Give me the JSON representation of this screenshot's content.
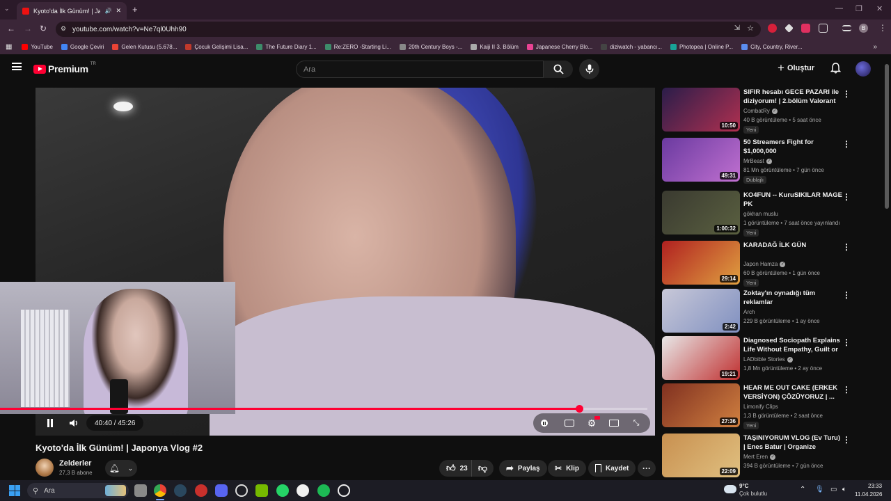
{
  "browser": {
    "tab_title": "Kyoto'da İlk Günüm! | Japor",
    "url": "youtube.com/watch?v=Ne7ql0Uhh90",
    "profile_initial": "B",
    "bookmarks": [
      {
        "label": "YouTube",
        "color": "#ff0000"
      },
      {
        "label": "Google Çeviri",
        "color": "#4285f4"
      },
      {
        "label": "Gelen Kutusu (5.678...",
        "color": "#ea4335"
      },
      {
        "label": "Çocuk Gelişimi Lisa...",
        "color": "#c0392b"
      },
      {
        "label": "The Future Diary 1...",
        "color": "#3d8c6a"
      },
      {
        "label": "Re:ZERO -Starting Li...",
        "color": "#3d8c6a"
      },
      {
        "label": "20th Century Boys -...",
        "color": "#888888"
      },
      {
        "label": "Kaiji II 3. Bölüm",
        "color": "#aaaaaa"
      },
      {
        "label": "Japanese Cherry Blo...",
        "color": "#e84393"
      },
      {
        "label": "diziwatch - yabancı...",
        "color": "#444444"
      },
      {
        "label": "Photopea | Online P...",
        "color": "#18a497"
      },
      {
        "label": "City, Country, River...",
        "color": "#5b8def"
      }
    ]
  },
  "youtube": {
    "logo_text": "Premium",
    "logo_sup": "TR",
    "search_placeholder": "Ara",
    "create_label": "Oluştur"
  },
  "player": {
    "time": "40:40 / 45:26",
    "progress": 0.8944
  },
  "video": {
    "title": "Kyoto'da İlk Günüm! | Japonya Vlog #2",
    "channel": "Zelderler",
    "subscribers": "27,3 B abone",
    "likes": "23",
    "share_label": "Paylaş",
    "clip_label": "Klip",
    "save_label": "Kaydet"
  },
  "recommendations": [
    {
      "title": "SIFIR hesabı GECE PAZARI ile diziyorum! | 2.bölüm Valorant",
      "channel": "CombatRy",
      "verified": true,
      "meta": "40 B görüntüleme • 5 saat önce",
      "badge": "Yeni",
      "duration": "10:50",
      "thumb": [
        "#2a1d4a",
        "#b03050"
      ]
    },
    {
      "title": "50 Streamers Fight for $1,000,000",
      "channel": "MrBeast",
      "verified": true,
      "meta": "81 Mn görüntüleme • 7 gün önce",
      "badge": "Dublajlı",
      "duration": "49:31",
      "thumb": [
        "#6a3aa0",
        "#c070d0"
      ]
    },
    {
      "title": "KO4FUN -- KuruSIKILAR MAGE PK",
      "channel": "gökhan muslu",
      "verified": false,
      "meta": "1 görüntüleme • 7 saat önce yayınlandı",
      "badge": "Yeni",
      "duration": "1:00:32",
      "thumb": [
        "#3a3a30",
        "#5a6040"
      ]
    },
    {
      "title": "KARADAĞ İLK GÜN",
      "channel": "Japon Hamza",
      "verified": true,
      "meta": "60 B görüntüleme • 1 gün önce",
      "badge": "Yeni",
      "duration": "29:14",
      "thumb": [
        "#b02020",
        "#e0a040"
      ]
    },
    {
      "title": "Zoktay'ın oynadığı tüm reklamlar",
      "channel": "Arch",
      "verified": false,
      "meta": "229 B görüntüleme • 1 ay önce",
      "badge": "",
      "duration": "2:42",
      "thumb": [
        "#c8c8d8",
        "#8090c0"
      ]
    },
    {
      "title": "Diagnosed Sociopath Explains Life Without Empathy, Guilt or ...",
      "channel": "LADbible Stories",
      "verified": true,
      "meta": "1,8 Mn görüntüleme • 2 ay önce",
      "badge": "",
      "duration": "19:21",
      "thumb": [
        "#e8e8e8",
        "#c03030"
      ]
    },
    {
      "title": "HEAR ME OUT CAKE (ERKEK VERSİYON) ÇÖZÜYORUZ | ...",
      "channel": "Limonify Clips",
      "verified": false,
      "meta": "1,3 B görüntüleme • 2 saat önce",
      "badge": "Yeni",
      "duration": "27:36",
      "thumb": [
        "#803020",
        "#d08040"
      ]
    },
    {
      "title": "TAŞINIYORUM VLOG (Ev Turu) | Enes Batur | Organize",
      "channel": "Mert Eren",
      "verified": true,
      "meta": "394 B görüntüleme • 7 gün önce",
      "badge": "",
      "duration": "22:09",
      "thumb": [
        "#c89050",
        "#e0c080"
      ]
    }
  ],
  "taskbar": {
    "search_label": "Ara",
    "temperature": "9°C",
    "weather": "Çok bulutlu",
    "time": "23:33",
    "date": "11.04.2026"
  }
}
